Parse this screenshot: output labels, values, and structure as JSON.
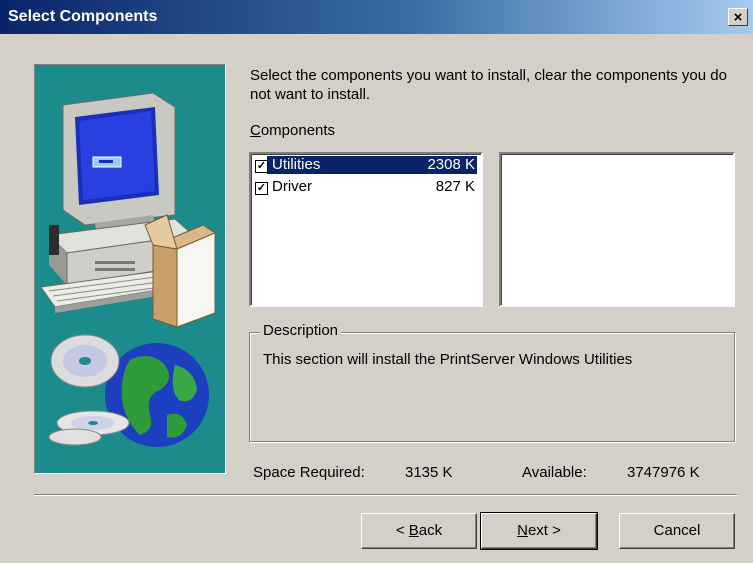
{
  "window": {
    "title": "Select Components",
    "close_glyph": "×"
  },
  "instructions": "Select the components you want to install, clear the components you do not want to install.",
  "components": {
    "label_mnemonic": "C",
    "label_rest": "omponents",
    "items": [
      {
        "name": "Utilities",
        "size": "2308 K",
        "checked": true,
        "selected": true
      },
      {
        "name": "Driver",
        "size": "827 K",
        "checked": true,
        "selected": false
      }
    ]
  },
  "description": {
    "legend": "Description",
    "text": "This section will install the PrintServer Windows Utilities"
  },
  "space": {
    "required_label": "Space Required:",
    "required_value": "3135 K",
    "available_label": "Available:",
    "available_value": "3747976 K"
  },
  "buttons": {
    "back_prefix": "< ",
    "back_mnemonic": "B",
    "back_rest": "ack",
    "next_mnemonic": "N",
    "next_rest": "ext >",
    "cancel": "Cancel"
  },
  "colors": {
    "titlebar_start": "#0a246a",
    "titlebar_end": "#a6caf0",
    "dialog_bg": "#d4d0c8",
    "art_bg": "#1b8b8b",
    "selection": "#0a246a"
  },
  "icons": {
    "check": "check-icon",
    "close": "close-icon",
    "computer": "computer-illustration",
    "globe": "globe-cd-illustration"
  }
}
